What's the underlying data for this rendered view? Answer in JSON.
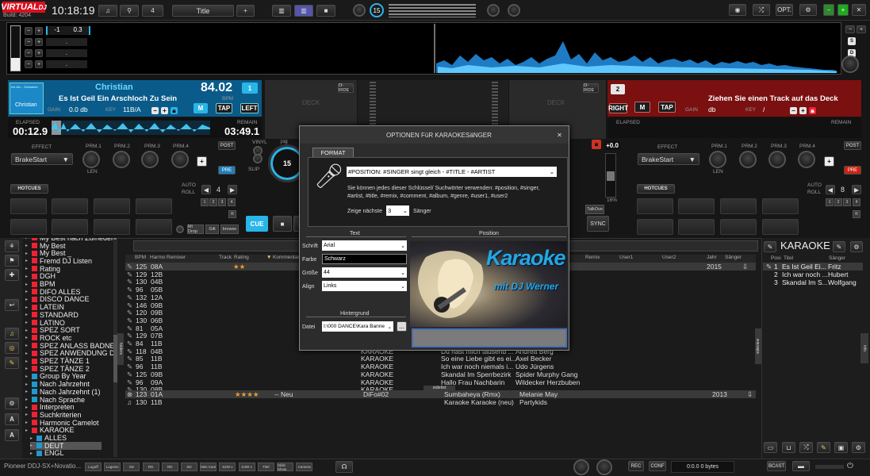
{
  "app": {
    "logo_top": "VIRTUAL",
    "logo_bottom": "DJ",
    "build": "Build: 4204",
    "clock": "10:18:19",
    "layout_count": "4",
    "layout_name": "Title",
    "opt": "OPT.",
    "center_num": "15"
  },
  "rec_pitch": {
    "val1": "-1",
    "val2": "0.3",
    "dot": "."
  },
  "deck_side": {
    "s": "S",
    "d": "D",
    "r": "R"
  },
  "deck1": {
    "mini": "Ich bin... Schweine",
    "title": "Christian",
    "bpm": "84.02",
    "bpm_label": "BPM",
    "subtitle": "Es Ist Geil Ein Arschloch Zu Sein",
    "artist": "Christian",
    "gain_label": "GAIN",
    "gain": "0.0 db",
    "key_label": "KEY",
    "key": "11B/A",
    "num": "1",
    "m": "M",
    "tap": "TAP",
    "left": "LEFT",
    "elapsed_label": "ELAPSED",
    "elapsed": "00:12.9",
    "remain_label": "REMAIN",
    "remain": "03:49.1"
  },
  "deck2": {
    "num": "2",
    "message": "Ziehen Sie einen Track auf das Deck",
    "gain_label": "GAIN",
    "gain": "db",
    "key_label": "KEY",
    "key": "/",
    "right": "RIGHT",
    "m": "M",
    "tap": "TAP",
    "elapsed_label": "ELAPSED",
    "remain_label": "REMAIN"
  },
  "decks_center": {
    "oride": "O-RIDE",
    "deck": "DECK",
    "vinyl": "VINYL",
    "jog": "jog",
    "slip": "SLIP",
    "jog_num": "15",
    "talkover": "TalkOve",
    "cue": "CUE",
    "sync": "SYNC"
  },
  "fx": {
    "effect_label": "EFFECT",
    "effect": "BrakeStart",
    "p1": "PRM.1",
    "p2": "PRM.2",
    "p3": "PRM.3",
    "p4": "PRM.4",
    "len": "LEN",
    "post": "POST",
    "pre": "PRE",
    "plus": "+",
    "fx_val": "+0.0",
    "pct": "16%"
  },
  "hotcues": {
    "label": "HOTCUES",
    "auto": "AUTO",
    "roll": "ROLL",
    "loop_left": "4",
    "loop_right": "8",
    "n1": "1",
    "n2": "2",
    "n3": "3",
    "n4": "4",
    "r": "R"
  },
  "small_buttons": {
    "mi_drop": "Mi Drop",
    "gilt": "Gilt",
    "browse": "browse"
  },
  "dialog": {
    "title": "OPTIONEN FüR KARAOKESäNGER",
    "tab": "FORMAT",
    "format_value": "#POSITION: #SINGER  singt gleich  -  #TITLE  - #ARTIST",
    "help": "Sie können jedes dieser Schlüssel/ Suchwörter verwenden: #position, #singer, #artist, #title, #remix, #comment, #album, #genre, #user1, #user2",
    "show_next_label": "Zeige nächste",
    "show_next": "3",
    "singers_label": "Sänger",
    "text_section": "Text",
    "position_section": "Position",
    "font_label": "Schrift",
    "font": "Arial",
    "color_label": "Farbe",
    "color": "Schwarz",
    "size_label": "Größe",
    "size": "44",
    "align_label": "Align",
    "align": "Links",
    "bg_section": "Hintergrund",
    "file_label": "Datei",
    "file": "I:\\000 DANCE\\Kara Banne",
    "browse_btn": "...",
    "preview_word": "Karaoke",
    "preview_sub": "mit DJ Werner"
  },
  "browser": {
    "tree": [
      {
        "name": "My Best nach Zufriedenheit",
        "icon": "#e23"
      },
      {
        "name": "My Best",
        "icon": "#e23"
      },
      {
        "name": "My Best _",
        "icon": "#e23"
      },
      {
        "name": "Fremd DJ Listen",
        "icon": "#e23"
      },
      {
        "name": "Rating",
        "icon": "#e23"
      },
      {
        "name": "DGH",
        "icon": "#e23"
      },
      {
        "name": "BPM",
        "icon": "#e23"
      },
      {
        "name": "DIFO ALLES",
        "icon": "#e23"
      },
      {
        "name": "DISCO DANCE",
        "icon": "#e23"
      },
      {
        "name": "LATEIN",
        "icon": "#e23"
      },
      {
        "name": "STANDARD",
        "icon": "#e23"
      },
      {
        "name": "LATINO",
        "icon": "#e23"
      },
      {
        "name": "SPEZ SORT",
        "icon": "#e23"
      },
      {
        "name": "ROCK etc",
        "icon": "#e23"
      },
      {
        "name": "SPEZ ANLASS BADNER",
        "icon": "#e23"
      },
      {
        "name": "SPEZ ANWENDUNG DINN",
        "icon": "#e23"
      },
      {
        "name": "SPEZ TÄNZE 1",
        "icon": "#e23"
      },
      {
        "name": "SPEZ TÄNZE 2",
        "icon": "#e23"
      },
      {
        "name": "Group By Year",
        "icon": "#29c"
      },
      {
        "name": "Nach Jahrzehnt",
        "icon": "#29c"
      },
      {
        "name": "Nach Jahrzehnt (1)",
        "icon": "#29c"
      },
      {
        "name": "Nach Sprache",
        "icon": "#29c"
      },
      {
        "name": "Interpreten",
        "icon": "#e23"
      },
      {
        "name": "Suchkriterien",
        "icon": "#e23"
      },
      {
        "name": "Harmonic Camelot",
        "icon": "#e23"
      },
      {
        "name": "KARAOKE",
        "icon": "#e23"
      },
      {
        "name": "ALLES",
        "icon": "#29c"
      },
      {
        "name": "DEUT",
        "icon": "#29c"
      },
      {
        "name": "ENGL",
        "icon": "#29c"
      }
    ],
    "columns": {
      "bpm": "BPM",
      "harmo": "Harmo",
      "remix": "Remixer",
      "track": "Track",
      "rating": "Rating",
      "kommentar": "Kommentar",
      "remix2": "Remix",
      "user1": "User1",
      "user2": "User2",
      "jahr": "Jahr",
      "saenger": "Sänger"
    },
    "rows": [
      {
        "bpm": "125",
        "key": "08A",
        "rating": "★★",
        "year": "2015",
        "title": "",
        "artist": "",
        "genre": ""
      },
      {
        "bpm": "129",
        "key": "12B",
        "rating": "",
        "year": "",
        "title": "",
        "artist": "",
        "genre": ""
      },
      {
        "bpm": "130",
        "key": "04B",
        "rating": "",
        "year": "",
        "title": "",
        "artist": "",
        "genre": ""
      },
      {
        "bpm": "96",
        "key": "05B",
        "rating": "",
        "year": "",
        "title": "",
        "artist": "",
        "genre": ""
      },
      {
        "bpm": "132",
        "key": "12A",
        "rating": "",
        "year": "",
        "title": "",
        "artist": "",
        "genre": ""
      },
      {
        "bpm": "146",
        "key": "09B",
        "rating": "",
        "year": "",
        "title": "",
        "artist": "",
        "genre": ""
      },
      {
        "bpm": "120",
        "key": "09B",
        "rating": "",
        "year": "",
        "title": "",
        "artist": "Tr...",
        "genre": ""
      },
      {
        "bpm": "130",
        "key": "06B",
        "rating": "",
        "year": "",
        "title": "",
        "artist": "",
        "genre": ""
      },
      {
        "bpm": "81",
        "key": "05A",
        "rating": "",
        "year": "",
        "title": "",
        "artist": "",
        "genre": ""
      },
      {
        "bpm": "129",
        "key": "07B",
        "rating": "",
        "year": "",
        "title": "",
        "artist": "en",
        "genre": ""
      },
      {
        "bpm": "84",
        "key": "11B",
        "rating": "",
        "year": "",
        "title": "",
        "artist": "",
        "genre": "KARAOKE"
      },
      {
        "bpm": "118",
        "key": "04B",
        "rating": "",
        "year": "",
        "title": "Du hast mich tausend ...",
        "artist": "Andrea Berg",
        "genre": "KARAOKE"
      },
      {
        "bpm": "85",
        "key": "11B",
        "rating": "",
        "year": "",
        "title": "So eine Liebe gibt es ei...",
        "artist": "Axel Becker",
        "genre": "KARAOKE"
      },
      {
        "bpm": "96",
        "key": "11B",
        "rating": "",
        "year": "",
        "title": "Ich war noch niemals i...",
        "artist": "Udo Jürgens",
        "genre": "KARAOKE"
      },
      {
        "bpm": "125",
        "key": "09B",
        "rating": "",
        "year": "",
        "title": "Skandal Im Sperrbezirk",
        "artist": "Spider Murphy Gang",
        "genre": "KARAOKE"
      },
      {
        "bpm": "96",
        "key": "09A",
        "rating": "",
        "year": "",
        "title": "Hallo Frau Nachbarin",
        "artist": "Wildecker Herzbuben",
        "genre": "KARAOKE"
      },
      {
        "bpm": "130",
        "key": "08B",
        "rating": "",
        "year": "",
        "title": "",
        "artist": "",
        "genre": "KARAOKE"
      }
    ],
    "sidelist_label": "sidelist",
    "sidelist_rows": [
      {
        "bpm": "123",
        "key": "01A",
        "rating": "★★★★",
        "comment": "-- Neu",
        "remix": "DiFo#02",
        "title": "Sumbaheya (Rmx)",
        "artist": "Melanie May",
        "year": "2013"
      },
      {
        "bpm": "130",
        "key": "11B",
        "rating": "",
        "comment": "",
        "remix": "",
        "title": "Karaoke Karaoke (neu)",
        "artist": "Partykids",
        "year": ""
      }
    ],
    "folders_tab": "folders",
    "sideview_tab": "sideview",
    "info_tab": "info"
  },
  "karaoke_panel": {
    "title": "KARAOKE",
    "col_pos": "Posi",
    "col_title": "Titel",
    "col_singer": "Sänger",
    "rows": [
      {
        "pos": "1",
        "title": "Es Ist Geil Ei...",
        "singer": "Fritz"
      },
      {
        "pos": "2",
        "title": "Ich war noch ...",
        "singer": "Hubert"
      },
      {
        "pos": "3",
        "title": "Skandal Im S...",
        "singer": "Wolfgang"
      }
    ]
  },
  "bottom": {
    "controller": "Pioneer DDJ-SX+Novatio...",
    "buttons": [
      "Logoff",
      "Logvien",
      "SD",
      "RD",
      "RD",
      "SD",
      "Mini Cam",
      "S2W v",
      "DJW v",
      "Titel",
      "Slide Show",
      "Camera"
    ],
    "rec": "REC",
    "conf": "CONF",
    "bytes": "0:0.0 0 bytes",
    "bcast": "BCAST"
  }
}
